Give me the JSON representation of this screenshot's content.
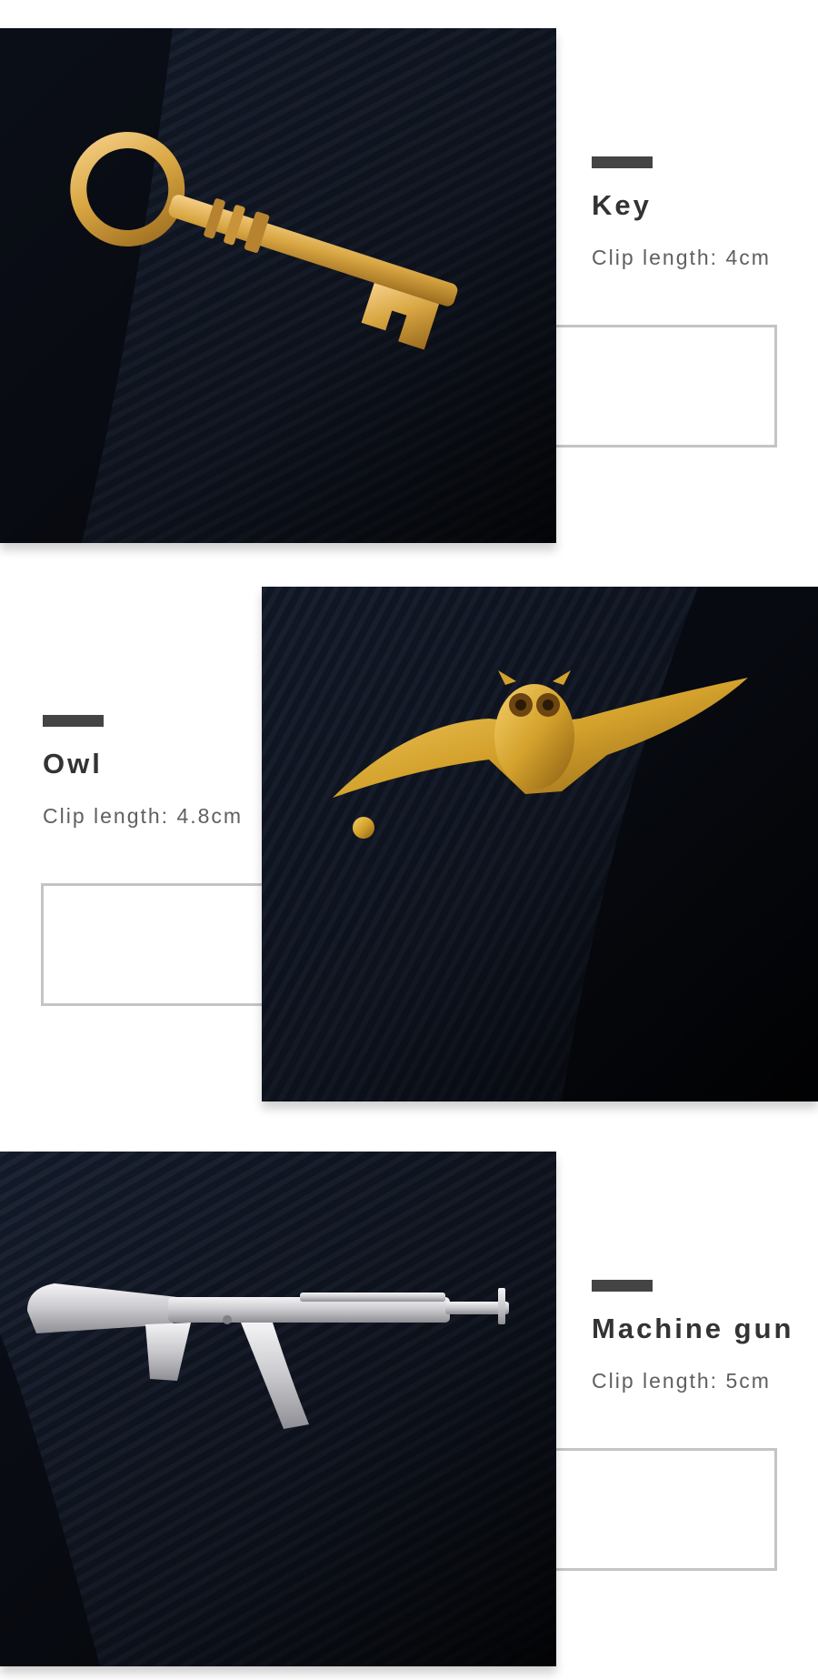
{
  "colors": {
    "accent_bar": "#444444",
    "title_text": "#333333",
    "spec_text": "#5f5f5f",
    "box_border": "#c4c4c4",
    "fabric_dark": "#0b0f18",
    "gold": "#d9a743",
    "silver": "#d8d8da"
  },
  "products": [
    {
      "name": "Key",
      "spec": "Clip length: 4cm",
      "image_icon": "gold-key-tie-clip",
      "image_side": "left"
    },
    {
      "name": "Owl",
      "spec": "Clip length: 4.8cm",
      "image_icon": "gold-owl-tie-clip",
      "image_side": "right"
    },
    {
      "name": "Machine gun",
      "spec": "Clip length: 5cm",
      "image_icon": "silver-rifle-tie-clip",
      "image_side": "left"
    }
  ]
}
